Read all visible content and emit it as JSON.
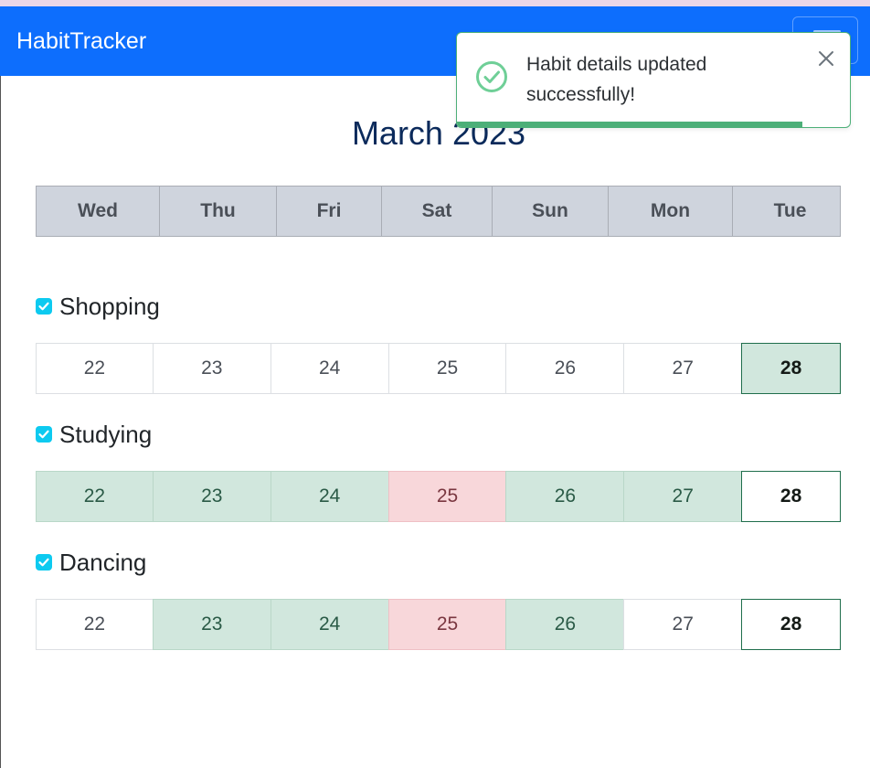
{
  "app": {
    "brand": "HabitTracker"
  },
  "calendar": {
    "month_title": "March 2023",
    "weekdays": [
      "Wed",
      "Thu",
      "Fri",
      "Sat",
      "Sun",
      "Mon",
      "Tue"
    ]
  },
  "habits": [
    {
      "name": "Shopping",
      "checked": true,
      "days": [
        {
          "day": "22",
          "status": "none"
        },
        {
          "day": "23",
          "status": "none"
        },
        {
          "day": "24",
          "status": "none"
        },
        {
          "day": "25",
          "status": "none"
        },
        {
          "day": "26",
          "status": "none"
        },
        {
          "day": "27",
          "status": "none"
        },
        {
          "day": "28",
          "status": "done",
          "today": true
        }
      ]
    },
    {
      "name": "Studying",
      "checked": true,
      "days": [
        {
          "day": "22",
          "status": "done"
        },
        {
          "day": "23",
          "status": "done"
        },
        {
          "day": "24",
          "status": "done"
        },
        {
          "day": "25",
          "status": "missed"
        },
        {
          "day": "26",
          "status": "done"
        },
        {
          "day": "27",
          "status": "done"
        },
        {
          "day": "28",
          "status": "none",
          "today": true
        }
      ]
    },
    {
      "name": "Dancing",
      "checked": true,
      "days": [
        {
          "day": "22",
          "status": "none"
        },
        {
          "day": "23",
          "status": "done"
        },
        {
          "day": "24",
          "status": "done"
        },
        {
          "day": "25",
          "status": "missed"
        },
        {
          "day": "26",
          "status": "done"
        },
        {
          "day": "27",
          "status": "none"
        },
        {
          "day": "28",
          "status": "none",
          "today": true
        }
      ]
    }
  ],
  "toast": {
    "message": "Habit details updated successfully!",
    "progress_percent": 88
  },
  "colors": {
    "navbar": "#0d6efd",
    "done": "#d1e7dd",
    "missed": "#f8d7da",
    "checkbox": "#0dcaf0",
    "toast_accent": "#4caf78"
  },
  "icons": {
    "toast": "check-circle-icon",
    "close": "close-icon",
    "menu": "hamburger-icon",
    "checkbox": "checkbox-checked-icon"
  }
}
